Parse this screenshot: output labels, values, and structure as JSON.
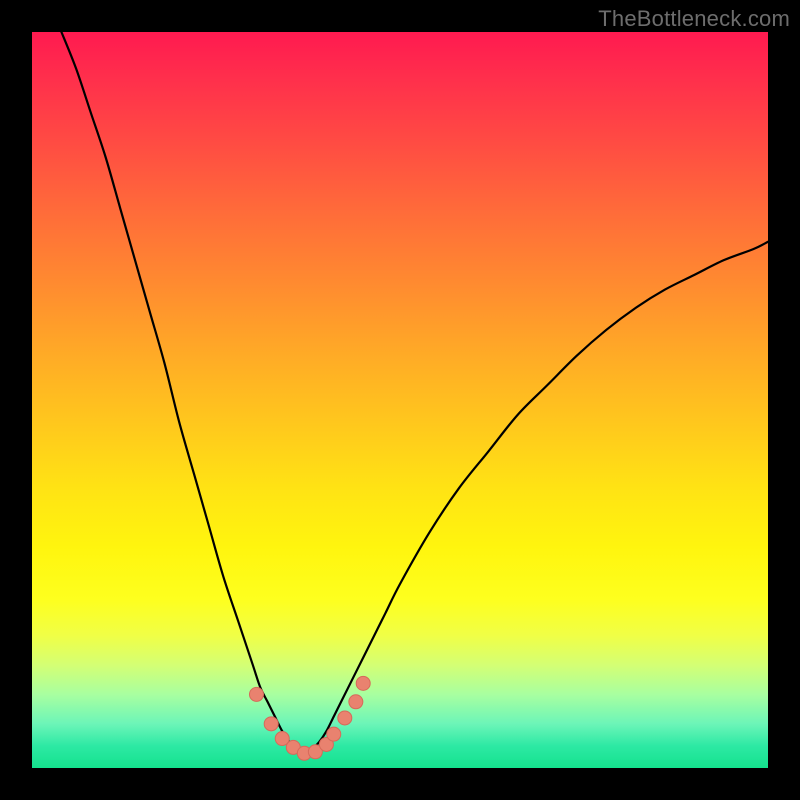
{
  "watermark": {
    "text": "TheBottleneck.com"
  },
  "colors": {
    "frame": "#000000",
    "curve": "#000000",
    "marker_fill": "#e9826f",
    "marker_stroke": "#d66a5a",
    "watermark_text": "#6d6d6d",
    "gradient_stops": [
      {
        "pos": 0.0,
        "hex": "#ff1a50"
      },
      {
        "pos": 0.24,
        "hex": "#ff6a3a"
      },
      {
        "pos": 0.54,
        "hex": "#ffca1c"
      },
      {
        "pos": 0.77,
        "hex": "#feff1e"
      },
      {
        "pos": 1.0,
        "hex": "#14e28e"
      }
    ]
  },
  "chart_data": {
    "type": "line",
    "title": "",
    "xlabel": "",
    "ylabel": "",
    "xlim": [
      0,
      100
    ],
    "ylim": [
      0,
      100
    ],
    "grid": false,
    "legend": false,
    "series": [
      {
        "name": "bottleneck-curve-left",
        "x": [
          4,
          6,
          8,
          10,
          12,
          14,
          16,
          18,
          20,
          22,
          24,
          26,
          28,
          30,
          31,
          32,
          33,
          34,
          35,
          36,
          37
        ],
        "y": [
          100,
          95,
          89,
          83,
          76,
          69,
          62,
          55,
          47,
          40,
          33,
          26,
          20,
          14,
          11,
          9,
          7,
          5,
          3.5,
          2.5,
          2
        ]
      },
      {
        "name": "bottleneck-curve-right",
        "x": [
          37,
          38,
          39,
          40,
          41,
          42,
          44,
          46,
          48,
          50,
          54,
          58,
          62,
          66,
          70,
          74,
          78,
          82,
          86,
          90,
          94,
          98,
          100
        ],
        "y": [
          2,
          2.5,
          3.5,
          5,
          7,
          9,
          13,
          17,
          21,
          25,
          32,
          38,
          43,
          48,
          52,
          56,
          59.5,
          62.5,
          65,
          67,
          69,
          70.5,
          71.5
        ]
      }
    ],
    "scatter_markers": {
      "name": "highlighted-points",
      "x": [
        30.5,
        32.5,
        34.0,
        35.5,
        37.0,
        38.5,
        40.0,
        41.0,
        42.5,
        44.0,
        45.0
      ],
      "y": [
        10.0,
        6.0,
        4.0,
        2.8,
        2.0,
        2.2,
        3.2,
        4.6,
        6.8,
        9.0,
        11.5
      ]
    },
    "notes": "x and y are in percent of plot width/height; y=0 is bottom, y=100 is top. Curve minimum ≈ (37, 2)."
  }
}
